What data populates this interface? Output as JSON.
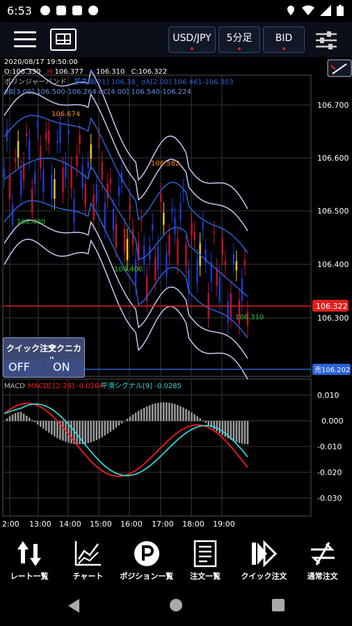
{
  "status_bar": {
    "time": "6:53"
  },
  "toolbar": {
    "pair": "USD/JPY",
    "timeframe": "5分足",
    "price_type": "BID"
  },
  "chart_info": {
    "datetime": "2020/08/17  19:50:00",
    "ohlc": {
      "open_label": "O:",
      "open": "106.330",
      "high_label": "H:",
      "high": "106.377",
      "low_label": "L:",
      "low": "106.310",
      "close_label": "C:",
      "close": "106.322"
    },
    "indicator_name": "ボリンジャーバンド",
    "bollinger_line1": "基準線[21] 106.38_  σA[2.00] 106.461-106.303",
    "bollinger_line2": "σB[3.00] 106.500-106.264  σC[4.00] 106.540-106.224"
  },
  "price_axis": [
    "106.700",
    "106.600",
    "106.500",
    "106.400",
    "106.300"
  ],
  "macd_axis": [
    "0.010",
    "0.000",
    "-0.010",
    "-0.020",
    "-0.030"
  ],
  "time_axis": [
    "2:00",
    "13:00",
    "14:00",
    "15:00",
    "16:00",
    "17:00",
    "18:00",
    "19:00"
  ],
  "markers": {
    "high_1": "106.674",
    "high_2": "106.582",
    "low_1": "106.490",
    "low_2": "106.400",
    "low_3": "106.310"
  },
  "current_price_tag": "106.322",
  "position_tag": "売106.202",
  "quick_order": {
    "label": "クイック注文",
    "state": "OFF"
  },
  "technical": {
    "label": "テクニカル",
    "state": "ON"
  },
  "macd": {
    "name": "MACD",
    "macd_label": "MACD[12-26] -0.0264",
    "signal_label": "平滑シグナル[9] -0.0285"
  },
  "bottom_nav": [
    {
      "label": "レート一覧",
      "icon": "rate-list-icon"
    },
    {
      "label": "チャート",
      "icon": "chart-icon"
    },
    {
      "label": "ポジション一覧",
      "icon": "position-icon"
    },
    {
      "label": "注文一覧",
      "icon": "order-list-icon"
    },
    {
      "label": "クイック注文",
      "icon": "quick-order-icon"
    },
    {
      "label": "通常注文",
      "icon": "normal-order-icon"
    }
  ],
  "colors": {
    "accent_red": "#e02020",
    "band_blue": "#2a62d8",
    "band_light": "#c7c8f5",
    "macd_red": "#ff1a1a",
    "signal_cyan": "#35d3d3",
    "candle_red": "#c8102e",
    "candle_blue": "#1a3bd6",
    "candle_yellow": "#f2d21b"
  }
}
